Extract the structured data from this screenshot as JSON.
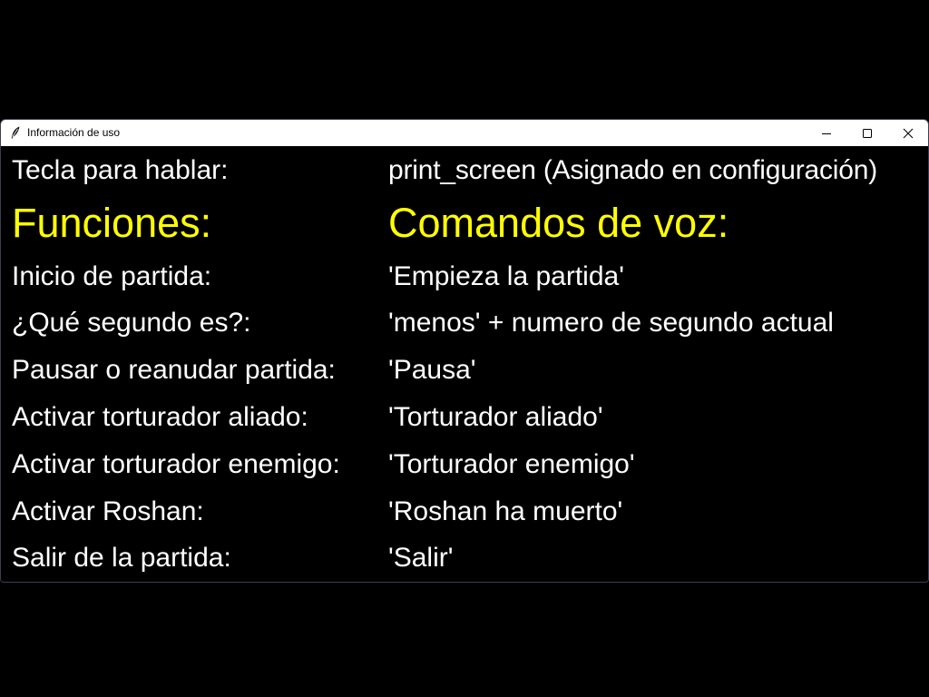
{
  "window": {
    "title": "Información de uso",
    "icon": "feather-icon"
  },
  "titlebar_buttons": {
    "minimize": "minimize-icon",
    "maximize": "maximize-icon",
    "close": "close-icon"
  },
  "colors": {
    "background": "#000000",
    "text": "#ffffff",
    "header": "#ffff00"
  },
  "hotkey": {
    "label": "Tecla para hablar:",
    "value": "print_screen (Asignado en configuración)"
  },
  "headers": {
    "functions": "Funciones:",
    "voice_commands": "Comandos de voz:"
  },
  "commands": [
    {
      "function": "Inicio de partida:",
      "command": "'Empieza la partida'"
    },
    {
      "function": "¿Qué segundo es?:",
      "command": "'menos' + numero de segundo actual"
    },
    {
      "function": "Pausar o reanudar partida:",
      "command": "'Pausa'"
    },
    {
      "function": "Activar torturador aliado:",
      "command": "'Torturador aliado'"
    },
    {
      "function": "Activar torturador enemigo:",
      "command": "'Torturador enemigo'"
    },
    {
      "function": "Activar Roshan:",
      "command": "'Roshan ha muerto'"
    },
    {
      "function": "Salir de la partida:",
      "command": "'Salir'"
    }
  ]
}
